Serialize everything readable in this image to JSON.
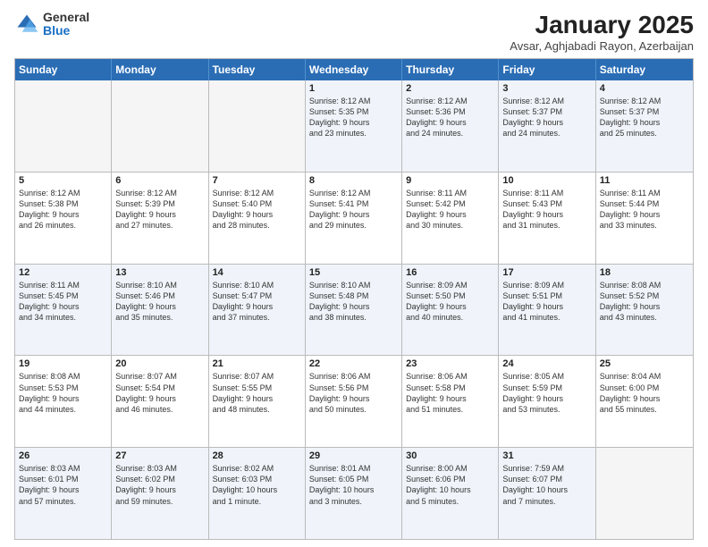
{
  "logo": {
    "general": "General",
    "blue": "Blue"
  },
  "title": "January 2025",
  "subtitle": "Avsar, Aghjabadi Rayon, Azerbaijan",
  "days_of_week": [
    "Sunday",
    "Monday",
    "Tuesday",
    "Wednesday",
    "Thursday",
    "Friday",
    "Saturday"
  ],
  "rows": [
    [
      {
        "day": "",
        "lines": []
      },
      {
        "day": "",
        "lines": []
      },
      {
        "day": "",
        "lines": []
      },
      {
        "day": "1",
        "lines": [
          "Sunrise: 8:12 AM",
          "Sunset: 5:35 PM",
          "Daylight: 9 hours",
          "and 23 minutes."
        ]
      },
      {
        "day": "2",
        "lines": [
          "Sunrise: 8:12 AM",
          "Sunset: 5:36 PM",
          "Daylight: 9 hours",
          "and 24 minutes."
        ]
      },
      {
        "day": "3",
        "lines": [
          "Sunrise: 8:12 AM",
          "Sunset: 5:37 PM",
          "Daylight: 9 hours",
          "and 24 minutes."
        ]
      },
      {
        "day": "4",
        "lines": [
          "Sunrise: 8:12 AM",
          "Sunset: 5:37 PM",
          "Daylight: 9 hours",
          "and 25 minutes."
        ]
      }
    ],
    [
      {
        "day": "5",
        "lines": [
          "Sunrise: 8:12 AM",
          "Sunset: 5:38 PM",
          "Daylight: 9 hours",
          "and 26 minutes."
        ]
      },
      {
        "day": "6",
        "lines": [
          "Sunrise: 8:12 AM",
          "Sunset: 5:39 PM",
          "Daylight: 9 hours",
          "and 27 minutes."
        ]
      },
      {
        "day": "7",
        "lines": [
          "Sunrise: 8:12 AM",
          "Sunset: 5:40 PM",
          "Daylight: 9 hours",
          "and 28 minutes."
        ]
      },
      {
        "day": "8",
        "lines": [
          "Sunrise: 8:12 AM",
          "Sunset: 5:41 PM",
          "Daylight: 9 hours",
          "and 29 minutes."
        ]
      },
      {
        "day": "9",
        "lines": [
          "Sunrise: 8:11 AM",
          "Sunset: 5:42 PM",
          "Daylight: 9 hours",
          "and 30 minutes."
        ]
      },
      {
        "day": "10",
        "lines": [
          "Sunrise: 8:11 AM",
          "Sunset: 5:43 PM",
          "Daylight: 9 hours",
          "and 31 minutes."
        ]
      },
      {
        "day": "11",
        "lines": [
          "Sunrise: 8:11 AM",
          "Sunset: 5:44 PM",
          "Daylight: 9 hours",
          "and 33 minutes."
        ]
      }
    ],
    [
      {
        "day": "12",
        "lines": [
          "Sunrise: 8:11 AM",
          "Sunset: 5:45 PM",
          "Daylight: 9 hours",
          "and 34 minutes."
        ]
      },
      {
        "day": "13",
        "lines": [
          "Sunrise: 8:10 AM",
          "Sunset: 5:46 PM",
          "Daylight: 9 hours",
          "and 35 minutes."
        ]
      },
      {
        "day": "14",
        "lines": [
          "Sunrise: 8:10 AM",
          "Sunset: 5:47 PM",
          "Daylight: 9 hours",
          "and 37 minutes."
        ]
      },
      {
        "day": "15",
        "lines": [
          "Sunrise: 8:10 AM",
          "Sunset: 5:48 PM",
          "Daylight: 9 hours",
          "and 38 minutes."
        ]
      },
      {
        "day": "16",
        "lines": [
          "Sunrise: 8:09 AM",
          "Sunset: 5:50 PM",
          "Daylight: 9 hours",
          "and 40 minutes."
        ]
      },
      {
        "day": "17",
        "lines": [
          "Sunrise: 8:09 AM",
          "Sunset: 5:51 PM",
          "Daylight: 9 hours",
          "and 41 minutes."
        ]
      },
      {
        "day": "18",
        "lines": [
          "Sunrise: 8:08 AM",
          "Sunset: 5:52 PM",
          "Daylight: 9 hours",
          "and 43 minutes."
        ]
      }
    ],
    [
      {
        "day": "19",
        "lines": [
          "Sunrise: 8:08 AM",
          "Sunset: 5:53 PM",
          "Daylight: 9 hours",
          "and 44 minutes."
        ]
      },
      {
        "day": "20",
        "lines": [
          "Sunrise: 8:07 AM",
          "Sunset: 5:54 PM",
          "Daylight: 9 hours",
          "and 46 minutes."
        ]
      },
      {
        "day": "21",
        "lines": [
          "Sunrise: 8:07 AM",
          "Sunset: 5:55 PM",
          "Daylight: 9 hours",
          "and 48 minutes."
        ]
      },
      {
        "day": "22",
        "lines": [
          "Sunrise: 8:06 AM",
          "Sunset: 5:56 PM",
          "Daylight: 9 hours",
          "and 50 minutes."
        ]
      },
      {
        "day": "23",
        "lines": [
          "Sunrise: 8:06 AM",
          "Sunset: 5:58 PM",
          "Daylight: 9 hours",
          "and 51 minutes."
        ]
      },
      {
        "day": "24",
        "lines": [
          "Sunrise: 8:05 AM",
          "Sunset: 5:59 PM",
          "Daylight: 9 hours",
          "and 53 minutes."
        ]
      },
      {
        "day": "25",
        "lines": [
          "Sunrise: 8:04 AM",
          "Sunset: 6:00 PM",
          "Daylight: 9 hours",
          "and 55 minutes."
        ]
      }
    ],
    [
      {
        "day": "26",
        "lines": [
          "Sunrise: 8:03 AM",
          "Sunset: 6:01 PM",
          "Daylight: 9 hours",
          "and 57 minutes."
        ]
      },
      {
        "day": "27",
        "lines": [
          "Sunrise: 8:03 AM",
          "Sunset: 6:02 PM",
          "Daylight: 9 hours",
          "and 59 minutes."
        ]
      },
      {
        "day": "28",
        "lines": [
          "Sunrise: 8:02 AM",
          "Sunset: 6:03 PM",
          "Daylight: 10 hours",
          "and 1 minute."
        ]
      },
      {
        "day": "29",
        "lines": [
          "Sunrise: 8:01 AM",
          "Sunset: 6:05 PM",
          "Daylight: 10 hours",
          "and 3 minutes."
        ]
      },
      {
        "day": "30",
        "lines": [
          "Sunrise: 8:00 AM",
          "Sunset: 6:06 PM",
          "Daylight: 10 hours",
          "and 5 minutes."
        ]
      },
      {
        "day": "31",
        "lines": [
          "Sunrise: 7:59 AM",
          "Sunset: 6:07 PM",
          "Daylight: 10 hours",
          "and 7 minutes."
        ]
      },
      {
        "day": "",
        "lines": []
      }
    ]
  ]
}
